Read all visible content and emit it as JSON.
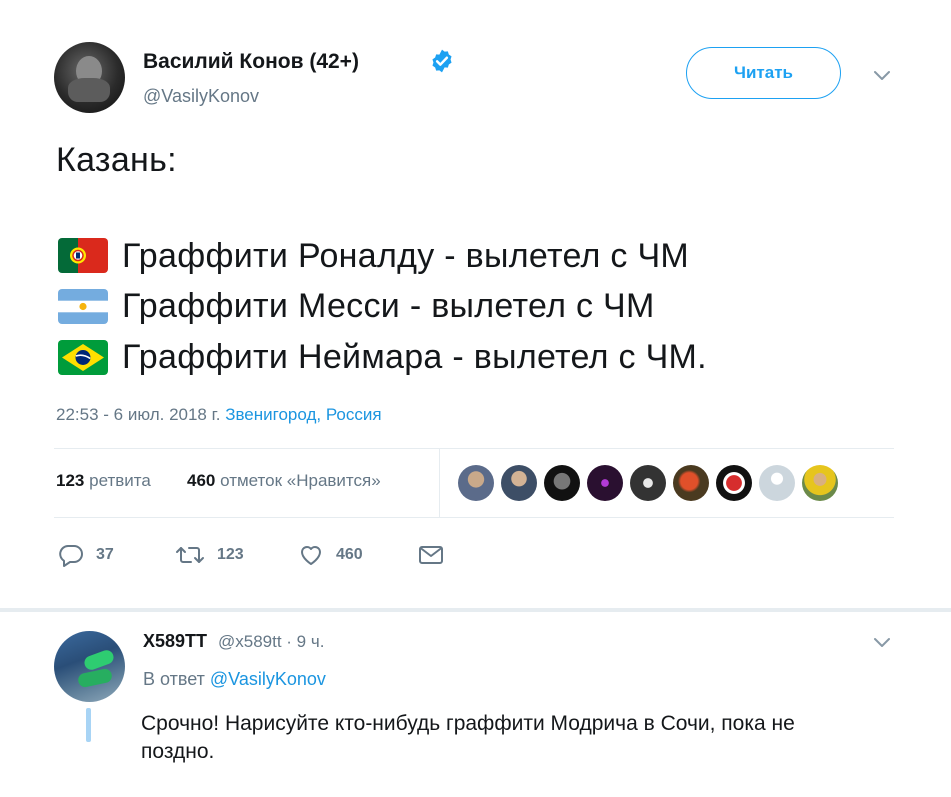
{
  "tweet": {
    "author": {
      "name": "Василий Конов (42+)",
      "handle": "@VasilyKonov",
      "verified": true
    },
    "follow_label": "Читать",
    "lines": [
      "Казань:",
      "Граффити Роналду - вылетел с ЧМ",
      "Граффити Месси - вылетел с ЧМ",
      "Граффити Неймара - вылетел с ЧМ."
    ],
    "flags": [
      "portugal-flag",
      "argentina-flag",
      "brazil-flag"
    ],
    "timestamp": "22:53 - 6 июл. 2018 г.",
    "location": "Звенигород, Россия",
    "stats": {
      "retweets_count": "123",
      "retweets_label": "ретвита",
      "likes_count": "460",
      "likes_label": "отметок «Нравится»"
    },
    "actions": {
      "reply_count": "37",
      "retweet_count": "123",
      "like_count": "460"
    }
  },
  "reply": {
    "name": "X589TT",
    "handle_time": "@x589tt · 9 ч.",
    "reply_to_prefix": "В ответ",
    "reply_to_mention": "@VasilyKonov",
    "text": "Срочно! Нарисуйте кто-нибудь граффити Модрича в Сочи, пока не поздно."
  },
  "colors": {
    "accent": "#1da1f2",
    "link": "#1b95e0",
    "muted": "#657786",
    "divider": "#e6ecf0"
  }
}
